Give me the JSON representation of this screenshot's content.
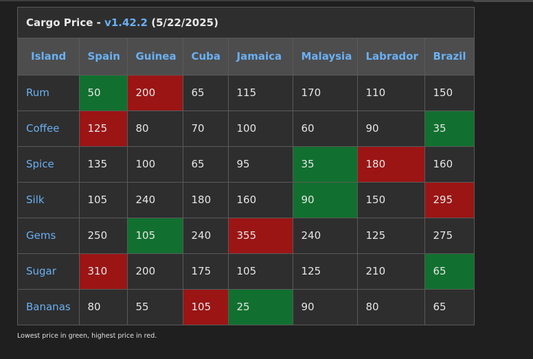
{
  "title": {
    "label": "Cargo Price - ",
    "version": "v1.42.2",
    "date": " (5/22/2025)"
  },
  "columns": [
    "Island",
    "Spain",
    "Guinea",
    "Cuba",
    "Jamaica",
    "Malaysia",
    "Labrador",
    "Brazil"
  ],
  "rows": [
    {
      "name": "Rum",
      "values": [
        "50",
        "200",
        "65",
        "115",
        "170",
        "110",
        "150"
      ],
      "status": [
        "low",
        "high",
        "",
        "",
        "",
        "",
        ""
      ]
    },
    {
      "name": "Coffee",
      "values": [
        "125",
        "80",
        "70",
        "100",
        "60",
        "90",
        "35"
      ],
      "status": [
        "high",
        "",
        "",
        "",
        "",
        "",
        "low"
      ]
    },
    {
      "name": "Spice",
      "values": [
        "135",
        "100",
        "65",
        "95",
        "35",
        "180",
        "160"
      ],
      "status": [
        "",
        "",
        "",
        "",
        "low",
        "high",
        ""
      ]
    },
    {
      "name": "Silk",
      "values": [
        "105",
        "240",
        "180",
        "160",
        "90",
        "150",
        "295"
      ],
      "status": [
        "",
        "",
        "",
        "",
        "low",
        "",
        "high"
      ]
    },
    {
      "name": "Gems",
      "values": [
        "250",
        "105",
        "240",
        "355",
        "240",
        "125",
        "275"
      ],
      "status": [
        "",
        "low",
        "",
        "high",
        "",
        "",
        ""
      ]
    },
    {
      "name": "Sugar",
      "values": [
        "310",
        "200",
        "175",
        "105",
        "125",
        "210",
        "65"
      ],
      "status": [
        "high",
        "",
        "",
        "",
        "",
        "",
        "low"
      ]
    },
    {
      "name": "Bananas",
      "values": [
        "80",
        "55",
        "105",
        "25",
        "90",
        "80",
        "65"
      ],
      "status": [
        "",
        "",
        "high",
        "low",
        "",
        "",
        ""
      ]
    }
  ],
  "colors": {
    "low": "#11702f",
    "high": "#9b1515",
    "accent": "#6ab0f3"
  },
  "footnote": "Lowest price in green, highest price in red."
}
